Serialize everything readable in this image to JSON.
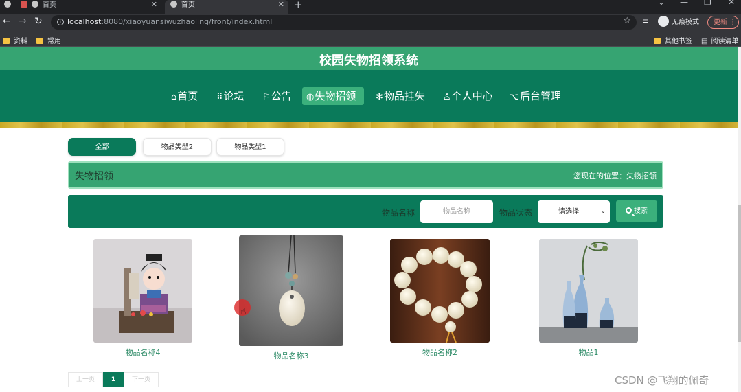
{
  "browser": {
    "tabs": [
      {
        "label": ""
      },
      {
        "label": "首页"
      },
      {
        "label": "首页"
      }
    ],
    "url_host": "localhost",
    "url_rest": ":8080/xiaoyuansiwuzhaoling/front/index.html",
    "incognito_label": "无痕模式",
    "update_label": "更新",
    "bookmarks": [
      "资料",
      "常用"
    ],
    "bookmarks_right": [
      "其他书签",
      "阅读清单"
    ]
  },
  "site": {
    "title": "校园失物招领系统",
    "nav": [
      {
        "icon": "home-icon",
        "glyph": "⌂",
        "label": "首页"
      },
      {
        "icon": "forum-icon",
        "glyph": "⠿",
        "label": "论坛"
      },
      {
        "icon": "flag-icon",
        "glyph": "⚐",
        "label": "公告"
      },
      {
        "icon": "globe-icon",
        "glyph": "◍",
        "label": "失物招领",
        "active": true
      },
      {
        "icon": "gear-icon",
        "glyph": "✻",
        "label": "物品挂失"
      },
      {
        "icon": "user-icon",
        "glyph": "♙",
        "label": "个人中心"
      },
      {
        "icon": "link-icon",
        "glyph": "🔗",
        "label": "后台管理"
      }
    ]
  },
  "filters": [
    "全部",
    "物品类型2",
    "物品类型1"
  ],
  "breadcrumb": {
    "title": "失物招领",
    "location": "您现在的位置：失物招领"
  },
  "search": {
    "name_label": "物品名称",
    "name_placeholder": "物品名称",
    "status_label": "物品状态",
    "status_value": "请选择",
    "button_label": "搜索"
  },
  "items": [
    {
      "name": "物品名称4"
    },
    {
      "name": "物品名称3"
    },
    {
      "name": "物品名称2"
    },
    {
      "name": "物品1"
    }
  ],
  "pagination": {
    "prev": "上一页",
    "current": "1",
    "next": "下一页"
  },
  "watermark": "CSDN @飞翔的佩奇",
  "colors": {
    "primary": "#0a7a5a",
    "accent": "#36a472",
    "button": "#3bb07c"
  }
}
